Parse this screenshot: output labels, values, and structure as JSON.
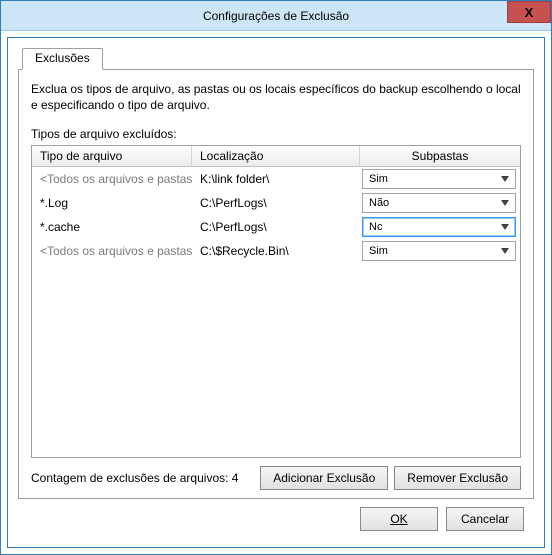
{
  "window": {
    "title": "Configurações de Exclusão",
    "close_icon": "X"
  },
  "tabs": {
    "exclusions_label": "Exclusões"
  },
  "panel": {
    "description": "Exclua os tipos de arquivo, as pastas ou os locais específicos do backup escolhendo o local e especificando o tipo de arquivo.",
    "section_label": "Tipos de arquivo excluídos:"
  },
  "grid": {
    "headers": {
      "type": "Tipo de arquivo",
      "location": "Localização",
      "subfolders": "Subpastas"
    },
    "rows": [
      {
        "type": "<Todos os arquivos e pastas>",
        "type_placeholder": true,
        "location": "K:\\link folder\\",
        "subfolders": "Sim",
        "active": false
      },
      {
        "type": "*.Log",
        "type_placeholder": false,
        "location": "C:\\PerfLogs\\",
        "subfolders": "Não",
        "active": false
      },
      {
        "type": "*.cache",
        "type_placeholder": false,
        "location": "C:\\PerfLogs\\",
        "subfolders": "Nc",
        "active": true
      },
      {
        "type": "<Todos os arquivos e pastas>",
        "type_placeholder": true,
        "location": "C:\\$Recycle.Bin\\",
        "subfolders": "Sim",
        "active": false
      }
    ]
  },
  "footer": {
    "count_label": "Contagem de exclusões de arquivos: 4",
    "add_label": "Adicionar Exclusão",
    "remove_label": "Remover Exclusão"
  },
  "buttons": {
    "ok_letter": "O",
    "ok_rest": "K",
    "cancel": "Cancelar"
  }
}
